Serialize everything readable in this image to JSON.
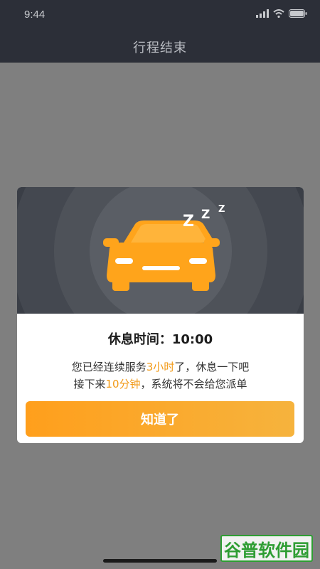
{
  "status_bar": {
    "time": "9:44"
  },
  "nav": {
    "title": "行程结束"
  },
  "modal": {
    "sleep_letters": [
      "Z",
      "Z",
      "Z"
    ],
    "rest_label": "休息时间：",
    "rest_time": "10:00",
    "line1": {
      "pre": "您已经连续服务",
      "highlight": "3小时",
      "post": "了，休息一下吧"
    },
    "line2": {
      "pre": "接下来",
      "highlight": "10分钟",
      "post": "，系统将不会给您派单"
    },
    "button_label": "知道了"
  },
  "watermark": {
    "text": "谷普软件园"
  },
  "colors": {
    "accent": "#f29a17",
    "button_start": "#ff9f1c",
    "button_end": "#f6b33d",
    "car": "#ffa41b"
  }
}
